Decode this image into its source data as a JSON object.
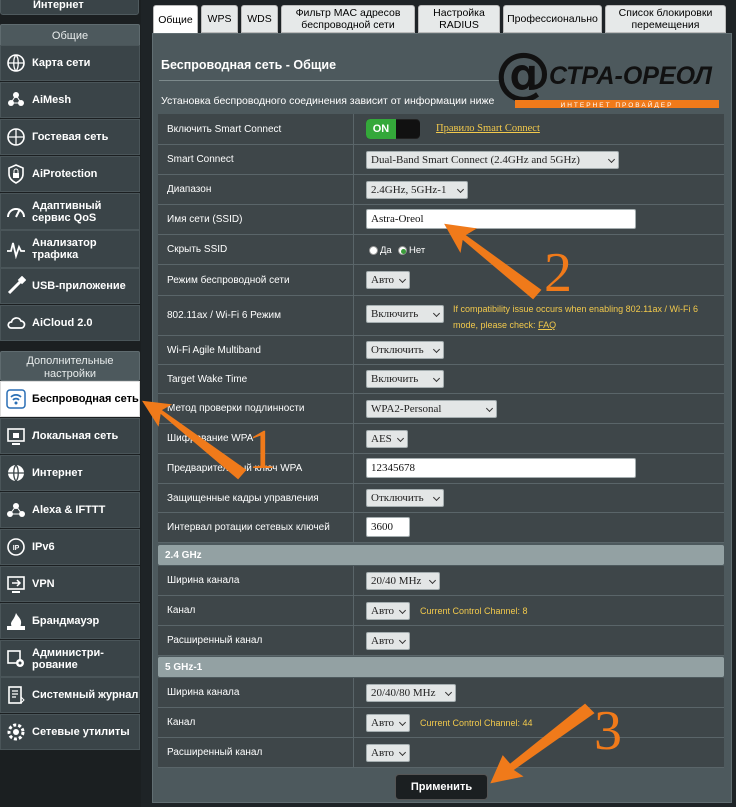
{
  "sidebar": {
    "top_item": "Интернет",
    "general_header": "Общие",
    "general_items": [
      {
        "label": "Карта сети",
        "icon": "network-map-icon"
      },
      {
        "label": "AiMesh",
        "icon": "aimesh-icon"
      },
      {
        "label": "Гостевая сеть",
        "icon": "guest-network-icon"
      },
      {
        "label": "AiProtection",
        "icon": "lock-shield-icon"
      },
      {
        "label": "Адаптивный сервис QoS",
        "icon": "qos-gauge-icon"
      },
      {
        "label": "Анализатор трафика",
        "icon": "traffic-analyzer-icon"
      },
      {
        "label": "USB-приложение",
        "icon": "usb-icon"
      },
      {
        "label": "AiCloud 2.0",
        "icon": "cloud-icon"
      }
    ],
    "advanced_header": "Дополнительные настройки",
    "advanced_items": [
      {
        "label": "Беспроводная сеть",
        "icon": "wifi-icon",
        "active": true
      },
      {
        "label": "Локальная сеть",
        "icon": "lan-icon"
      },
      {
        "label": "Интернет",
        "icon": "globe-icon"
      },
      {
        "label": "Alexa & IFTTT",
        "icon": "alexa-icon"
      },
      {
        "label": "IPv6",
        "icon": "ipv6-icon"
      },
      {
        "label": "VPN",
        "icon": "vpn-icon"
      },
      {
        "label": "Брандмауэр",
        "icon": "firewall-icon"
      },
      {
        "label": "Администри-рование",
        "icon": "admin-gear-icon"
      },
      {
        "label": "Системный журнал",
        "icon": "system-log-icon"
      },
      {
        "label": "Сетевые утилиты",
        "icon": "network-tools-icon"
      }
    ]
  },
  "tabs": [
    "Общие",
    "WPS",
    "WDS",
    "Фильтр MAC адресов беспроводной сети",
    "Настройка RADIUS",
    "Профессионально",
    "Список блокировки перемещения"
  ],
  "page": {
    "title": "Беспроводная сеть - Общие",
    "description": "Установка беспроводного соединения зависит от информации ниже",
    "logo_text": "СТРА-ОРЕОЛ",
    "logo_sub": "ИНТЕРНЕТ ПРОВАЙДЕР"
  },
  "form": {
    "smart_connect": {
      "label": "Включить Smart Connect",
      "toggle": "ON",
      "link": "Правило Smart Connect"
    },
    "smart_connect_mode": {
      "label": "Smart Connect",
      "value": "Dual-Band Smart Connect (2.4GHz and 5GHz)"
    },
    "band": {
      "label": "Диапазон",
      "value": "2.4GHz, 5GHz-1"
    },
    "ssid": {
      "label": "Имя сети (SSID)",
      "value": "Astra-Oreol"
    },
    "hide_ssid": {
      "label": "Скрыть SSID",
      "yes": "Да",
      "no": "Нет",
      "selected": "Нет"
    },
    "wireless_mode": {
      "label": "Режим беспроводной сети",
      "value": "Авто"
    },
    "wifi6": {
      "label": "802.11ax / Wi-Fi 6 Режим",
      "value": "Включить",
      "note": "If compatibility issue occurs when enabling 802.11ax / Wi-Fi 6 mode, please check:",
      "faq": "FAQ"
    },
    "agile": {
      "label": "Wi-Fi Agile Multiband",
      "value": "Отключить"
    },
    "twt": {
      "label": "Target Wake Time",
      "value": "Включить"
    },
    "auth": {
      "label": "Метод проверки подлинности",
      "value": "WPA2-Personal"
    },
    "wpa_enc": {
      "label": "Шифрование WPA",
      "value": "AES"
    },
    "wpa_key": {
      "label": "Предварительный ключ WPA",
      "value": "12345678"
    },
    "pmf": {
      "label": "Защищенные кадры управления",
      "value": "Отключить"
    },
    "key_rotation": {
      "label": "Интервал ротации сетевых ключей",
      "value": "3600"
    }
  },
  "band24": {
    "header": "2.4 GHz",
    "width": {
      "label": "Ширина канала",
      "value": "20/40 MHz"
    },
    "channel": {
      "label": "Канал",
      "value": "Авто",
      "note": "Current Control Channel: 8"
    },
    "ext": {
      "label": "Расширенный канал",
      "value": "Авто"
    }
  },
  "band5": {
    "header": "5 GHz-1",
    "width": {
      "label": "Ширина канала",
      "value": "20/40/80 MHz"
    },
    "channel": {
      "label": "Канал",
      "value": "Авто",
      "note": "Current Control Channel: 44"
    },
    "ext": {
      "label": "Расширенный канал",
      "value": "Авто"
    }
  },
  "apply_label": "Применить",
  "annotations": [
    "1",
    "2",
    "3"
  ],
  "colors": {
    "accent": "#f07a1a",
    "panel": "#4d595d",
    "toggle_on": "#34a83a",
    "note": "#f2c94c"
  }
}
